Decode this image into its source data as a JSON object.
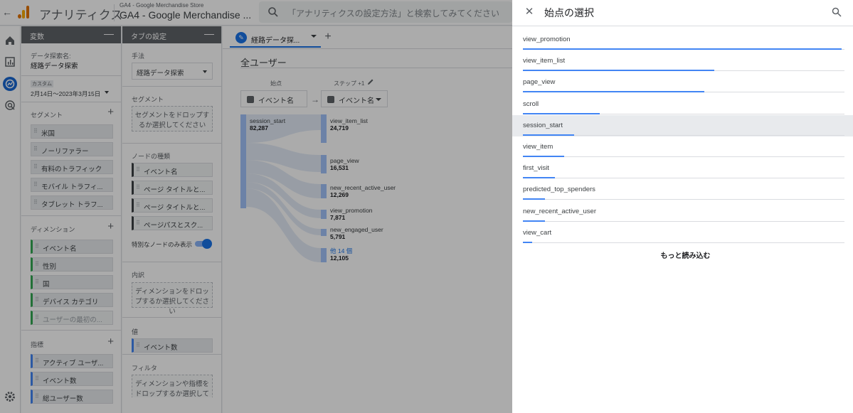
{
  "header": {
    "app_name": "アナリティクス",
    "account_small": "GA4 - Google Merchandise Store",
    "account_big": "GA4 - Google Merchandise ...",
    "search_placeholder": "「アナリティクスの設定方法」と検索してみてください"
  },
  "variables_panel": {
    "title": "変数",
    "exploration_name_label": "データ探索名:",
    "exploration_name": "経路データ探索",
    "date_label": "カスタム",
    "date_value": "2月14日～2023年3月15日",
    "segments_title": "セグメント",
    "segments": [
      "米国",
      "ノーリファラー",
      "有料のトラフィック",
      "モバイル トラフィ...",
      "タブレット トラフ..."
    ],
    "dimensions_title": "ディメンション",
    "dimensions": [
      "イベント名",
      "性別",
      "国",
      "デバイス カテゴリ",
      "ユーザーの最初の..."
    ],
    "metrics_title": "指標",
    "metrics": [
      "アクティブ ユーザ...",
      "イベント数",
      "総ユーザー数"
    ]
  },
  "tab_settings_panel": {
    "title": "タブの設定",
    "technique_label": "手法",
    "technique_value": "経路データ探索",
    "segment_label": "セグメント",
    "segment_drop": "セグメントをドロップするか選択してください",
    "node_type_label": "ノードの種類",
    "node_types": [
      "イベント名",
      "ページ タイトルと...",
      "ページ タイトルと...",
      "ページパスとスク..."
    ],
    "unique_nodes_label": "特別なノードのみ表示",
    "breakdown_label": "内訳",
    "breakdown_drop": "ディメンションをドロップするか選択してください",
    "value_label": "値",
    "value_chip": "イベント数",
    "filter_label": "フィルタ",
    "filter_drop": "ディメンションや指標をドロップするか選択してくださ い"
  },
  "canvas": {
    "tab_label": "経路データ探...",
    "add_tab": "+",
    "segment_title": "全ユーザー",
    "start_label": "始点",
    "step_label": "ステップ +1",
    "start_select": "イベント名",
    "step_select": "イベント名",
    "start_node": {
      "name": "session_start",
      "value": "82,287"
    },
    "step_nodes": [
      {
        "name": "view_item_list",
        "value": "24,719"
      },
      {
        "name": "page_view",
        "value": "16,531"
      },
      {
        "name": "new_recent_active_user",
        "value": "12,269"
      },
      {
        "name": "view_promotion",
        "value": "7,871"
      },
      {
        "name": "new_engaged_user",
        "value": "5,791"
      },
      {
        "name": "他 14 個",
        "value": "12,105"
      }
    ]
  },
  "drawer": {
    "title": "始点の選択",
    "options": [
      {
        "label": "view_promotion",
        "share": 1.0
      },
      {
        "label": "view_item_list",
        "share": 0.6
      },
      {
        "label": "page_view",
        "share": 0.57
      },
      {
        "label": "scroll",
        "share": 0.24
      },
      {
        "label": "session_start",
        "share": 0.16
      },
      {
        "label": "view_item",
        "share": 0.13
      },
      {
        "label": "first_visit",
        "share": 0.1
      },
      {
        "label": "predicted_top_spenders",
        "share": 0.07
      },
      {
        "label": "new_recent_active_user",
        "share": 0.07
      },
      {
        "label": "view_cart",
        "share": 0.03
      }
    ],
    "highlighted": "session_start",
    "load_more": "もっと読み込む"
  },
  "colors": {
    "accent": "#1a73e8",
    "bar": "#4285f4",
    "node": "#a1c2fa",
    "logo_orange": "#f9ab00",
    "logo_dark": "#e37400"
  }
}
